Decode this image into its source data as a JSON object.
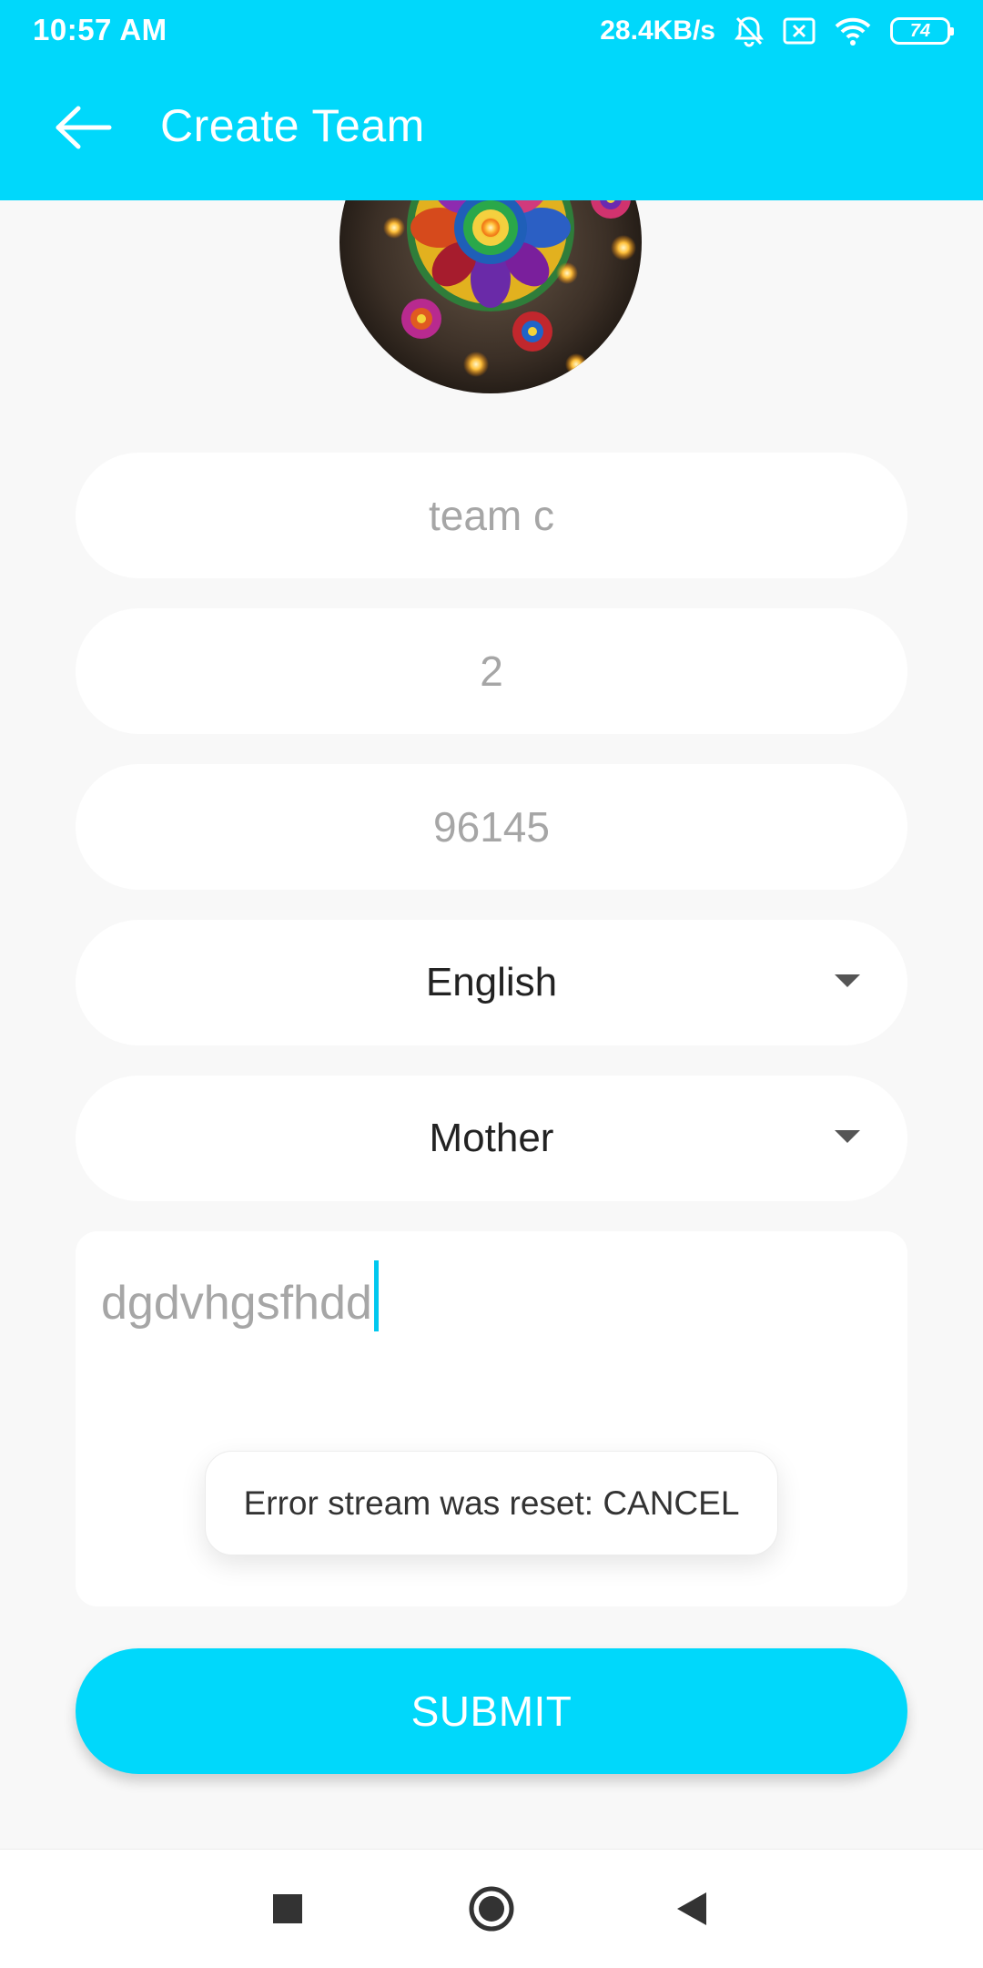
{
  "status_bar": {
    "time": "10:57 AM",
    "network_speed": "28.4KB/s",
    "battery_level": "74",
    "icons": [
      "bell-muted-icon",
      "sim-x-icon",
      "wifi-icon",
      "battery-icon"
    ]
  },
  "toolbar": {
    "title": "Create Team",
    "back_icon": "arrow-left-icon"
  },
  "avatar": {
    "icon": "team-avatar-image"
  },
  "form": {
    "team_name": "team c",
    "number": "2",
    "code": "96145",
    "language": "English",
    "relation": "Mother",
    "description": "dgdvhgsfhdd"
  },
  "toast": {
    "message": "Error stream was reset: CANCEL"
  },
  "submit": {
    "label": "SUBMIT"
  },
  "nav_bar": {
    "icons": [
      "square-icon",
      "circle-icon",
      "back-triangle-icon"
    ]
  },
  "colors": {
    "accent": "#00d8fb",
    "background": "#f8f8f8",
    "field_background": "#ffffff",
    "hint_text": "#a6a6a6"
  }
}
